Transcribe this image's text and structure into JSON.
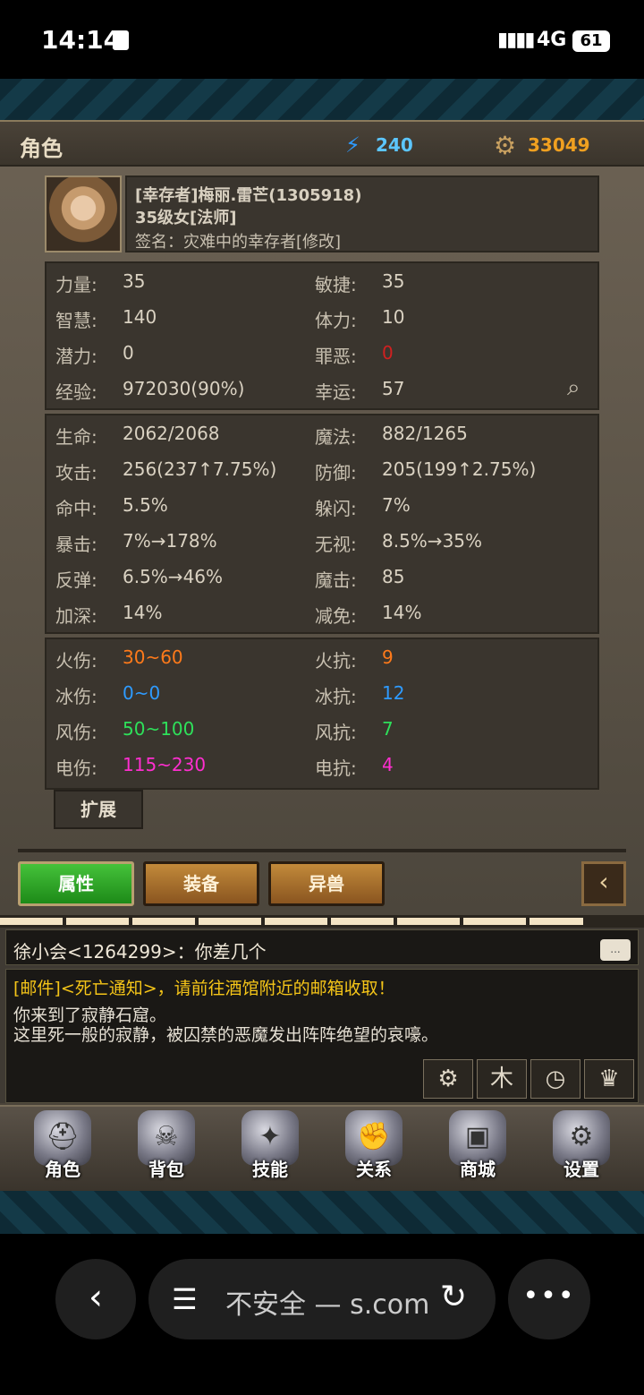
{
  "statusbar": {
    "time": "14:14",
    "network": "4G",
    "battery": "61"
  },
  "header": {
    "title": "角色",
    "mana": "240",
    "gold": "33049"
  },
  "profile": {
    "name": "[幸存者]梅丽.雷芒(1305918)",
    "level": "35级女[法师]",
    "signature": "签名：灾难中的幸存者[修改]"
  },
  "base_stats": [
    {
      "label": "力量:",
      "value": "35",
      "label2": "敏捷:",
      "value2": "35"
    },
    {
      "label": "智慧:",
      "value": "140",
      "label2": "体力:",
      "value2": "10"
    },
    {
      "label": "潜力:",
      "value": "0",
      "label2": "罪恶:",
      "value2": "0"
    },
    {
      "label": "经验:",
      "value": "972030(90%)",
      "label2": "幸运:",
      "value2": "57"
    }
  ],
  "combat_stats": [
    {
      "label": "生命:",
      "value": "2062/2068",
      "label2": "魔法:",
      "value2": "882/1265"
    },
    {
      "label": "攻击:",
      "value": "256(237↑7.75%)",
      "label2": "防御:",
      "value2": "205(199↑2.75%)"
    },
    {
      "label": "命中:",
      "value": "5.5%",
      "label2": "躲闪:",
      "value2": "7%"
    },
    {
      "label": "暴击:",
      "value": "7%→178%",
      "label2": "无视:",
      "value2": "8.5%→35%"
    },
    {
      "label": "反弹:",
      "value": "6.5%→46%",
      "label2": "魔击:",
      "value2": "85"
    },
    {
      "label": "加深:",
      "value": "14%",
      "label2": "减免:",
      "value2": "14%"
    }
  ],
  "element_stats": [
    {
      "label": "火伤:",
      "value": "30~60",
      "label2": "火抗:",
      "value2": "9",
      "color": "#ff7a1a"
    },
    {
      "label": "冰伤:",
      "value": "0~0",
      "label2": "冰抗:",
      "value2": "12",
      "color": "#2e9bff"
    },
    {
      "label": "风伤:",
      "value": "50~100",
      "label2": "风抗:",
      "value2": "7",
      "color": "#2ee05a"
    },
    {
      "label": "电伤:",
      "value": "115~230",
      "label2": "电抗:",
      "value2": "4",
      "color": "#ff2ed0"
    }
  ],
  "colors": {
    "sin_value": "#d02020"
  },
  "expand_label": "扩展",
  "tabs": {
    "attributes": "属性",
    "equipment": "装备",
    "beast": "异兽"
  },
  "chat": {
    "whisper": "徐小会<1264299>：你差几个",
    "mail": "[邮件]<死亡通知>，请前往酒馆附近的邮箱收取！",
    "line1": "你来到了寂静石窟。",
    "line2": "这里死一般的寂静，被囚禁的恶魔发出阵阵绝望的哀嚎。"
  },
  "nav": [
    "角色",
    "背包",
    "技能",
    "关系",
    "商城",
    "设置"
  ],
  "browser": {
    "url": "不安全 — s.com"
  }
}
